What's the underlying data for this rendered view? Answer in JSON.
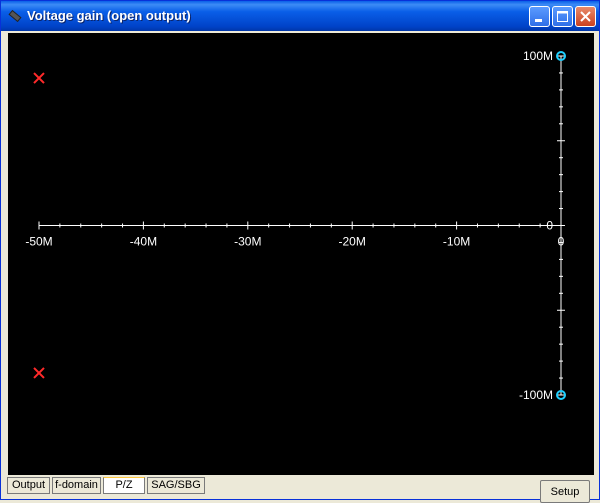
{
  "window": {
    "title": "Voltage gain (open output)"
  },
  "setup_label": "Setup",
  "tabs": [
    {
      "label": "Output",
      "active": false
    },
    {
      "label": "f-domain",
      "active": false
    },
    {
      "label": "P/Z",
      "active": true
    },
    {
      "label": "SAG/SBG",
      "active": false
    }
  ],
  "colors": {
    "background": "#000000",
    "axis": "#ffffff",
    "pole": "#ff2a2a",
    "zero": "#1fd0ff"
  },
  "chart_data": {
    "type": "scatter",
    "xlim": [
      -50000000,
      0
    ],
    "ylim": [
      -100000000,
      100000000
    ],
    "x_ticks": [
      {
        "value": -50000000,
        "label": "-50M"
      },
      {
        "value": -40000000,
        "label": "-40M"
      },
      {
        "value": -30000000,
        "label": "-30M"
      },
      {
        "value": -20000000,
        "label": "-20M"
      },
      {
        "value": -10000000,
        "label": "-10M"
      },
      {
        "value": 0,
        "label": "0"
      }
    ],
    "y_ticks": [
      {
        "value": 100000000,
        "label": "100M"
      },
      {
        "value": 0,
        "label": "0"
      },
      {
        "value": -100000000,
        "label": "-100M"
      }
    ],
    "series": [
      {
        "marker": "x",
        "points": [
          [
            -50000000,
            87000000
          ],
          [
            -50000000,
            -87000000
          ]
        ]
      },
      {
        "marker": "o",
        "points": [
          [
            0,
            100000000
          ],
          [
            0,
            -100000000
          ]
        ]
      }
    ]
  }
}
